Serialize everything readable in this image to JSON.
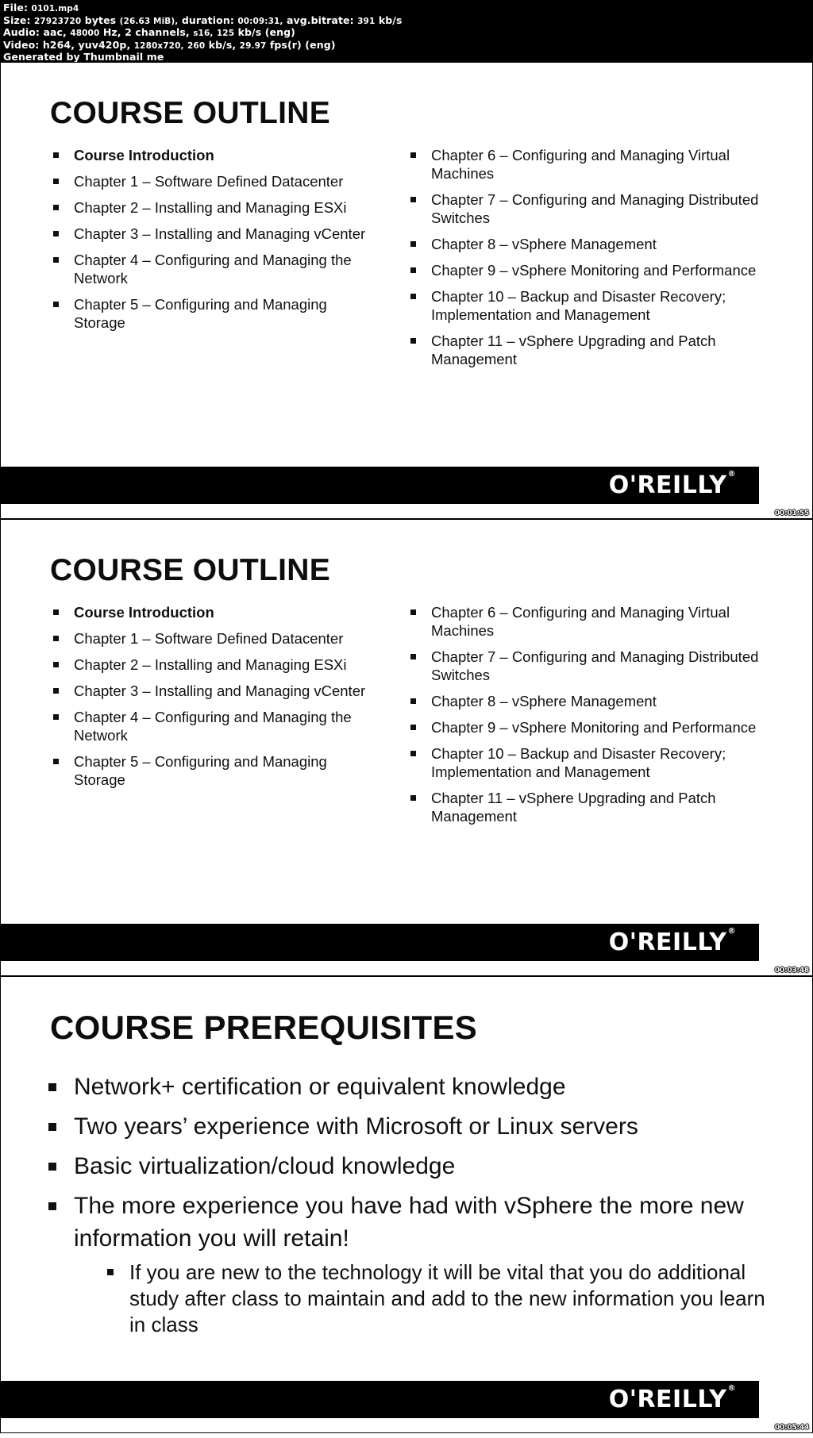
{
  "meta": {
    "file_label": "File:",
    "file_name": "0101.mp4",
    "size_label": "Size:",
    "size_value": "27923720 bytes (26.63 MiB), duration: 00:09:31, avg.bitrate: 391 kb/s",
    "size_bytes": "27923720",
    "size_bytes_unit": "bytes",
    "size_human": "(26.63 MiB),",
    "duration_label": "duration:",
    "duration_value": "00:09:31,",
    "bitrate_label": "avg.bitrate:",
    "bitrate_value": "391",
    "bitrate_unit": "kb/s",
    "audio_label": "Audio:",
    "audio_codec": "aac,",
    "audio_rate": "48000",
    "audio_rate_unit": "Hz,",
    "audio_channels": "2 channels,",
    "audio_sample_fmt": "s16,",
    "audio_bitrate": "125",
    "audio_bitrate_unit": "kb/s (eng)",
    "video_label": "Video:",
    "video_codec": "h264,",
    "video_pixfmt": "yuv420p,",
    "video_resolution": "1280x720,",
    "video_bitrate": "260",
    "video_bitrate_unit": "kb/s,",
    "video_fps": "29.97",
    "video_fps_unit": "fps(r) (eng)",
    "generator": "Generated by Thumbnail me"
  },
  "brand": {
    "logo_text": "O'REILLY",
    "trademark": "®",
    "bar_color": "#000000",
    "logo_color": "#ffffff"
  },
  "frames": [
    {
      "timestamp": "00:01:55",
      "slide": {
        "kind": "outline",
        "title": "COURSE OUTLINE",
        "left_column": [
          {
            "text": "Course Introduction",
            "bold": true
          },
          {
            "text": "Chapter 1 – Software Defined Datacenter",
            "bold": false
          },
          {
            "text": "Chapter 2 – Installing and Managing ESXi",
            "bold": false
          },
          {
            "text": "Chapter 3 – Installing and Managing vCenter",
            "bold": false
          },
          {
            "text": "Chapter 4 – Configuring and Managing the Network",
            "bold": false
          },
          {
            "text": "Chapter 5 – Configuring and Managing Storage",
            "bold": false
          }
        ],
        "right_column": [
          {
            "text": "Chapter 6 – Configuring and Managing Virtual Machines",
            "bold": false
          },
          {
            "text": "Chapter 7 – Configuring and Managing Distributed Switches",
            "bold": false
          },
          {
            "text": "Chapter 8 – vSphere Management",
            "bold": false
          },
          {
            "text": "Chapter 9 – vSphere Monitoring and Performance",
            "bold": false
          },
          {
            "text": "Chapter 10 – Backup and Disaster Recovery; Implementation and Management",
            "bold": false
          },
          {
            "text": "Chapter 11 – vSphere Upgrading and Patch Management",
            "bold": false
          }
        ]
      }
    },
    {
      "timestamp": "00:03:48",
      "slide": {
        "kind": "outline",
        "title": "COURSE OUTLINE",
        "left_column": [
          {
            "text": "Course Introduction",
            "bold": true
          },
          {
            "text": "Chapter 1 – Software Defined Datacenter",
            "bold": false
          },
          {
            "text": "Chapter 2 – Installing and Managing ESXi",
            "bold": false
          },
          {
            "text": "Chapter 3 – Installing and Managing vCenter",
            "bold": false
          },
          {
            "text": "Chapter 4 – Configuring and Managing the Network",
            "bold": false
          },
          {
            "text": "Chapter 5 – Configuring and Managing Storage",
            "bold": false
          }
        ],
        "right_column": [
          {
            "text": "Chapter 6 – Configuring and Managing Virtual Machines",
            "bold": false
          },
          {
            "text": "Chapter 7 – Configuring and Managing Distributed Switches",
            "bold": false
          },
          {
            "text": "Chapter 8 – vSphere Management",
            "bold": false
          },
          {
            "text": "Chapter 9 – vSphere Monitoring and Performance",
            "bold": false
          },
          {
            "text": "Chapter 10 – Backup and Disaster Recovery; Implementation and Management",
            "bold": false
          },
          {
            "text": "Chapter 11 – vSphere Upgrading and Patch Management",
            "bold": false
          }
        ]
      }
    },
    {
      "timestamp": "00:05:44",
      "slide": {
        "kind": "prerequisites",
        "title": "COURSE PREREQUISITES",
        "bullets": [
          {
            "text": "Network+ certification or equivalent knowledge",
            "sub": null
          },
          {
            "text": "Two years’ experience with Microsoft or Linux servers",
            "sub": null
          },
          {
            "text": "Basic virtualization/cloud knowledge",
            "sub": null
          },
          {
            "text": "The more experience you have had with vSphere the more new information you will retain!",
            "sub": "If you are new to the technology it will be vital that you do additional study after class to maintain and add to the new information you learn in class"
          }
        ]
      }
    }
  ]
}
